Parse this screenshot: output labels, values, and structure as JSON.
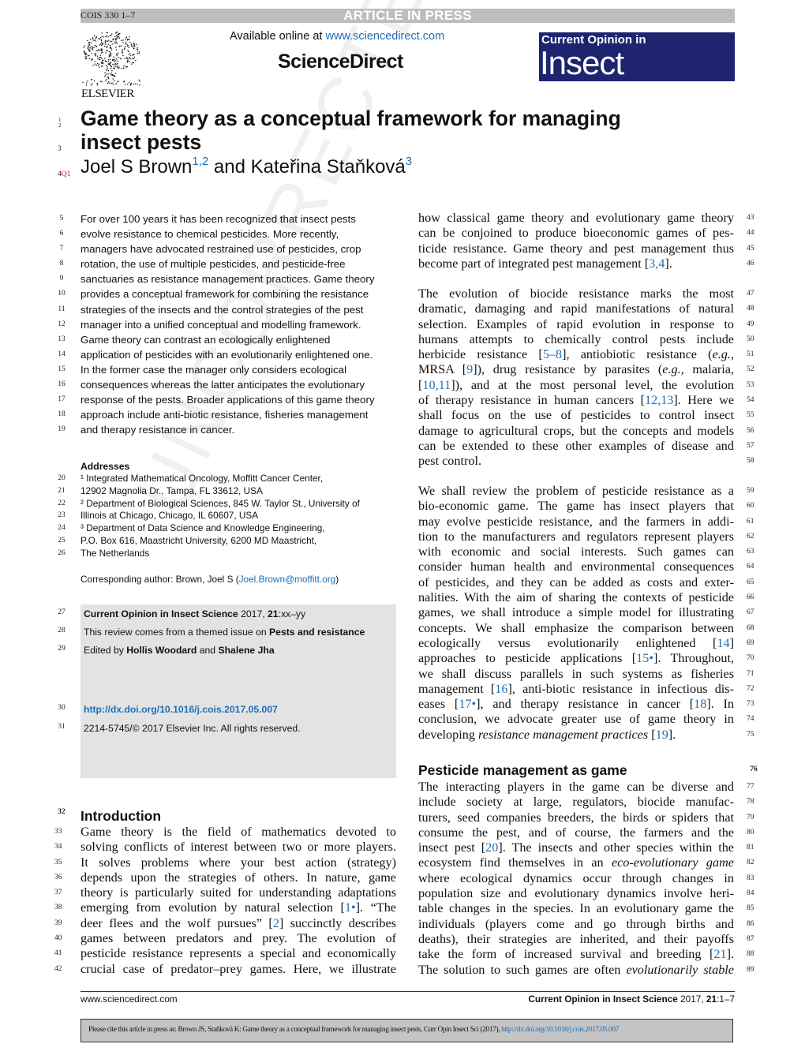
{
  "header": {
    "doc_code": "COIS 330 1–7",
    "banner": "ARTICLE IN PRESS",
    "available_prefix": "Available online at ",
    "available_link": "www.sciencedirect.com",
    "platform": "ScienceDirect",
    "publisher": "ELSEVIER",
    "journal_line1": "Current Opinion in",
    "journal_line2": "Insect Science",
    "journal_color": "#1e2470"
  },
  "article": {
    "title_line1": "Game theory as a conceptual framework for managing",
    "title_line2": "insect pests",
    "author1": "Joel S Brown",
    "author1_sup": "1,2",
    "and": " and ",
    "author2": "Kateřina Staňková",
    "author2_sup": "3",
    "title_line_numbers": [
      "1",
      "2",
      "3",
      "4"
    ],
    "query_mark": "Q1"
  },
  "watermark": "UNCORRECTED PROOF",
  "abstract": [
    {
      "n": "5",
      "t": "For over 100 years it has been recognized that insect pests"
    },
    {
      "n": "6",
      "t": "evolve resistance to chemical pesticides. More recently,"
    },
    {
      "n": "7",
      "t": "managers have advocated restrained use of pesticides, crop"
    },
    {
      "n": "8",
      "t": "rotation, the use of multiple pesticides, and pesticide-free"
    },
    {
      "n": "9",
      "t": "sanctuaries as resistance management practices. Game theory"
    },
    {
      "n": "10",
      "t": "provides a conceptual framework for combining the resistance"
    },
    {
      "n": "11",
      "t": "strategies of the insects and the control strategies of the pest"
    },
    {
      "n": "12",
      "t": "manager into a unified conceptual and modelling framework."
    },
    {
      "n": "13",
      "t": "Game theory can contrast an ecologically enlightened"
    },
    {
      "n": "14",
      "t": "application of pesticides with an evolutionarily enlightened one."
    },
    {
      "n": "15",
      "t": "In the former case the manager only considers ecological"
    },
    {
      "n": "16",
      "t": "consequences whereas the latter anticipates the evolutionary"
    },
    {
      "n": "17",
      "t": "response of the pests. Broader applications of this game theory"
    },
    {
      "n": "18",
      "t": "approach include anti-biotic resistance, fisheries management"
    },
    {
      "n": "19",
      "t": "and therapy resistance in cancer."
    }
  ],
  "addresses": {
    "heading": "Addresses",
    "lines": [
      {
        "n": "20",
        "t": "¹ Integrated Mathematical Oncology, Moffitt Cancer Center,"
      },
      {
        "n": "21",
        "t": "12902 Magnolia Dr., Tampa, FL 33612, USA"
      },
      {
        "n": "22",
        "t": "² Department of Biological Sciences, 845 W. Taylor St., University of"
      },
      {
        "n": "23",
        "t": "Illinois at Chicago, Chicago, IL 60607, USA"
      },
      {
        "n": "24",
        "t": "³ Department of Data Science and Knowledge Engineering,"
      },
      {
        "n": "25",
        "t": "P.O. Box 616, Maastricht University, 6200 MD Maastricht,"
      },
      {
        "n": "26",
        "t": "The Netherlands"
      }
    ],
    "corresponding": "Corresponding author: Brown, Joel S ({Joel.Brown@moffitt.org})"
  },
  "infobox": [
    {
      "n": "27",
      "t": "**Current Opinion in Insect Science** 2017, **21**:xx–yy"
    },
    {
      "n": "28",
      "t": "This review comes from a themed issue on **Pests and resistance**"
    },
    {
      "n": "29",
      "t": "Edited by **Hollis Woodard** and **Shalene Jha**"
    },
    {
      "n": "30",
      "t": "{http://dx.doi.org/10.1016/j.cois.2017.05.007}"
    },
    {
      "n": "31",
      "t": "2214-5745/© 2017 Elsevier Inc. All rights reserved."
    }
  ],
  "introduction": {
    "heading": "Introduction",
    "heading_n": "32",
    "lines": [
      {
        "n": "33",
        "t": "Game theory is the field of mathematics devoted to"
      },
      {
        "n": "34",
        "t": "solving conflicts of interest between two or more players."
      },
      {
        "n": "35",
        "t": "It solves problems where your best action (strategy)"
      },
      {
        "n": "36",
        "t": "depends upon the strategies of others. In nature, game"
      },
      {
        "n": "37",
        "t": "theory is particularly suited for understanding adaptations"
      },
      {
        "n": "38",
        "t": "emerging from evolution by natural selection [1•]. “The"
      },
      {
        "n": "39",
        "t": "deer flees and the wolf pursues” [2] succinctly describes"
      },
      {
        "n": "40",
        "t": "games between predators and prey. The evolution of"
      },
      {
        "n": "41",
        "t": "pesticide resistance represents a special and economically"
      },
      {
        "n": "42",
        "t": "crucial case of predator–prey games. Here, we illustrate"
      }
    ]
  },
  "right_paragraphs": [
    [
      {
        "n": "43",
        "t": "how classical game theory and evolutionary game theory"
      },
      {
        "n": "44",
        "t": "can be conjoined to produce bioeconomic games of pes-"
      },
      {
        "n": "45",
        "t": "ticide resistance. Game theory and pest management thus"
      },
      {
        "n": "46",
        "t": "become part of integrated pest management [3,4].",
        "last": true
      }
    ],
    [
      {
        "n": "47",
        "t": "The evolution of biocide resistance marks the most"
      },
      {
        "n": "48",
        "t": "dramatic, damaging and rapid manifestations of natural"
      },
      {
        "n": "49",
        "t": "selection. Examples of rapid evolution in response to"
      },
      {
        "n": "50",
        "t": "humans attempts to chemically control pests include"
      },
      {
        "n": "51",
        "t": "herbicide resistance [5–8], antiobiotic resistance (*e.g.,*"
      },
      {
        "n": "52",
        "t": "MRSA [9]), drug resistance by parasites (*e.g.,* malaria,"
      },
      {
        "n": "53",
        "t": "[10,11]), and at the most personal level, the evolution"
      },
      {
        "n": "54",
        "t": "of therapy resistance in human cancers [12,13]. Here we"
      },
      {
        "n": "55",
        "t": "shall focus on the use of pesticides to control insect"
      },
      {
        "n": "56",
        "t": "damage to agricultural crops, but the concepts and models"
      },
      {
        "n": "57",
        "t": "can be extended to these other examples of disease and"
      },
      {
        "n": "58",
        "t": "pest control.",
        "last": true
      }
    ],
    [
      {
        "n": "59",
        "t": "We shall review the problem of pesticide resistance as a"
      },
      {
        "n": "60",
        "t": "bio-economic game. The game has insect players that"
      },
      {
        "n": "61",
        "t": "may evolve pesticide resistance, and the farmers in addi-"
      },
      {
        "n": "62",
        "t": "tion to the manufacturers and regulators represent players"
      },
      {
        "n": "63",
        "t": "with economic and social interests. Such games can"
      },
      {
        "n": "64",
        "t": "consider human health and environmental consequences"
      },
      {
        "n": "65",
        "t": "of pesticides, and they can be added as costs and exter-"
      },
      {
        "n": "66",
        "t": "nalities. With the aim of sharing the contexts of pesticide"
      },
      {
        "n": "67",
        "t": "games, we shall introduce a simple model for illustrating"
      },
      {
        "n": "68",
        "t": "concepts. We shall emphasize the comparison between"
      },
      {
        "n": "69",
        "t": "ecologically versus evolutionarily enlightened [14]"
      },
      {
        "n": "70",
        "t": "approaches to pesticide applications [15•]. Throughout,"
      },
      {
        "n": "71",
        "t": "we shall discuss parallels in such systems as fisheries"
      },
      {
        "n": "72",
        "t": "management [16], anti-biotic resistance in infectious dis-"
      },
      {
        "n": "73",
        "t": "eases [17•], and therapy resistance in cancer [18]. In"
      },
      {
        "n": "74",
        "t": "conclusion, we advocate greater use of game theory in"
      },
      {
        "n": "75",
        "t": "developing *resistance management practices* [19].",
        "last": true
      }
    ]
  ],
  "section2": {
    "heading": "Pesticide management as game",
    "heading_n": "76",
    "lines": [
      {
        "n": "77",
        "t": "The interacting players in the game can be diverse and"
      },
      {
        "n": "78",
        "t": "include society at large, regulators, biocide manufac-"
      },
      {
        "n": "79",
        "t": "turers, seed companies breeders, the birds or spiders that"
      },
      {
        "n": "80",
        "t": "consume the pest, and of course, the farmers and the"
      },
      {
        "n": "81",
        "t": "insect pest [20]. The insects and other species within the"
      },
      {
        "n": "82",
        "t": "ecosystem find themselves in an *eco-evolutionary game*"
      },
      {
        "n": "83",
        "t": "where ecological dynamics occur through changes in"
      },
      {
        "n": "84",
        "t": "population size and evolutionary dynamics involve heri-"
      },
      {
        "n": "85",
        "t": "table changes in the species. In an evolutionary game the"
      },
      {
        "n": "86",
        "t": "individuals (players come and go through births and"
      },
      {
        "n": "87",
        "t": "deaths), their strategies are inherited, and their payoffs"
      },
      {
        "n": "88",
        "t": "take the form of increased survival and breeding [21]."
      },
      {
        "n": "89",
        "t": "The solution to such games are often *evolutionarily stable*"
      }
    ]
  },
  "footer": {
    "site": "www.sciencedirect.com",
    "journal_bold": "Current Opinion in Insect Science",
    "year": " 2017, ",
    "volume": "21",
    "pages": ":1–7",
    "cite": "Please cite this article in press as: Brown JS, Staňková K: Game theory as a conceptual framework for managing insect pests, Curr Opin Insect Sci (2017), {http://dx.doi.org/10.1016/j.cois.2017.05.007}"
  },
  "colors": {
    "link": "#1f6fb5",
    "banner": "#bdbdbd",
    "infobox": "#e3e3e3",
    "query": "#dd0000"
  }
}
